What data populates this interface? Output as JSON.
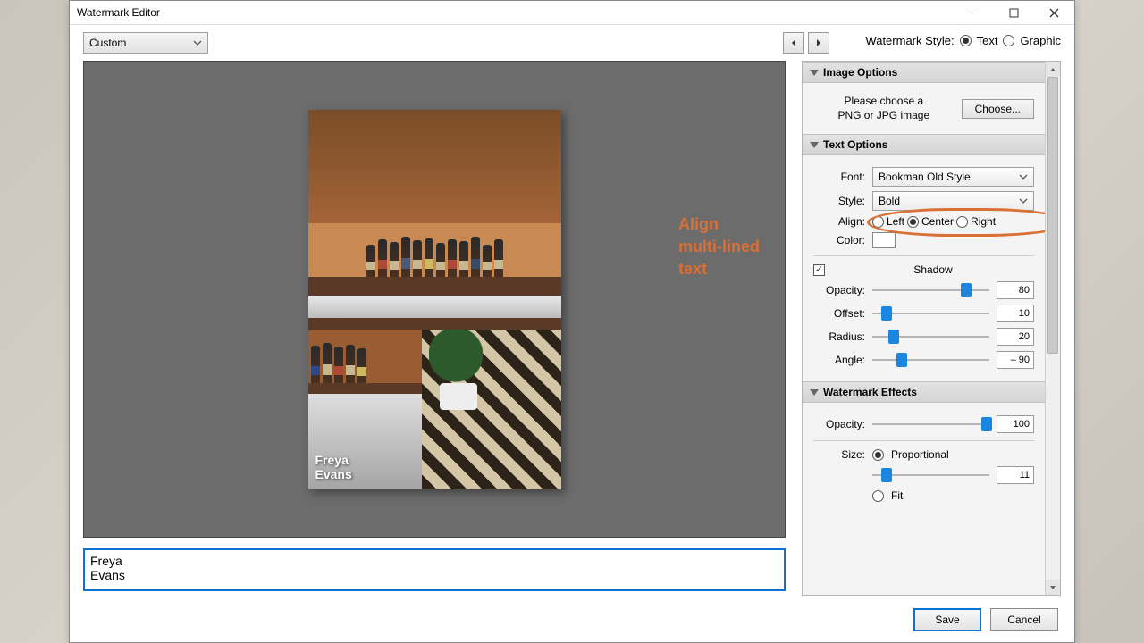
{
  "window": {
    "title": "Watermark Editor"
  },
  "preset": {
    "value": "Custom"
  },
  "watermark_style": {
    "label": "Watermark Style:",
    "text": "Text",
    "graphic": "Graphic",
    "selected": "Text"
  },
  "sections": {
    "image_options": {
      "title": "Image Options",
      "hint_line1": "Please choose a",
      "hint_line2": "PNG or JPG image",
      "choose_btn": "Choose..."
    },
    "text_options": {
      "title": "Text Options",
      "font_label": "Font:",
      "font_value": "Bookman Old Style",
      "style_label": "Style:",
      "style_value": "Bold",
      "align_label": "Align:",
      "align_left": "Left",
      "align_center": "Center",
      "align_right": "Right",
      "align_selected": "Center",
      "color_label": "Color:",
      "shadow_label": "Shadow",
      "opacity_label": "Opacity:",
      "opacity_value": "80",
      "offset_label": "Offset:",
      "offset_value": "10",
      "radius_label": "Radius:",
      "radius_value": "20",
      "angle_label": "Angle:",
      "angle_value": "– 90"
    },
    "watermark_effects": {
      "title": "Watermark Effects",
      "opacity_label": "Opacity:",
      "opacity_value": "100",
      "size_label": "Size:",
      "size_proportional": "Proportional",
      "size_value": "11",
      "size_fit": "Fit"
    }
  },
  "watermark_text": {
    "line1": "Freya",
    "line2": "Evans",
    "value": "Freya\nEvans"
  },
  "annotation": {
    "line1": "Align",
    "line2": "multi-lined",
    "line3": "text"
  },
  "footer": {
    "save": "Save",
    "cancel": "Cancel"
  }
}
